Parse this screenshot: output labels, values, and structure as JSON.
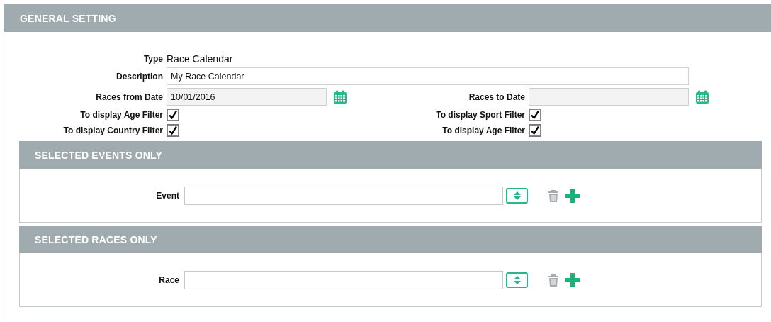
{
  "general_setting": {
    "title": "GENERAL SETTING",
    "type": {
      "label": "Type",
      "value": "Race Calendar"
    },
    "description": {
      "label": "Description",
      "value": "My Race Calendar"
    },
    "date_fields": [
      {
        "label": "Races from Date",
        "value": "10/01/2016"
      },
      {
        "label": "Races to Date"
      }
    ],
    "checkboxes": [
      {
        "label": "To display Age Filter",
        "checked": true
      },
      {
        "label": "To display Sport Filter",
        "checked": true
      },
      {
        "label": "To display Country Filter",
        "checked": true
      },
      {
        "label": "To display Age Filter",
        "checked": true
      }
    ]
  },
  "sections": [
    {
      "title": "SELECTED EVENTS ONLY",
      "field_label": "Event"
    },
    {
      "title": "SELECTED RACES ONLY",
      "field_label": "Race"
    }
  ]
}
